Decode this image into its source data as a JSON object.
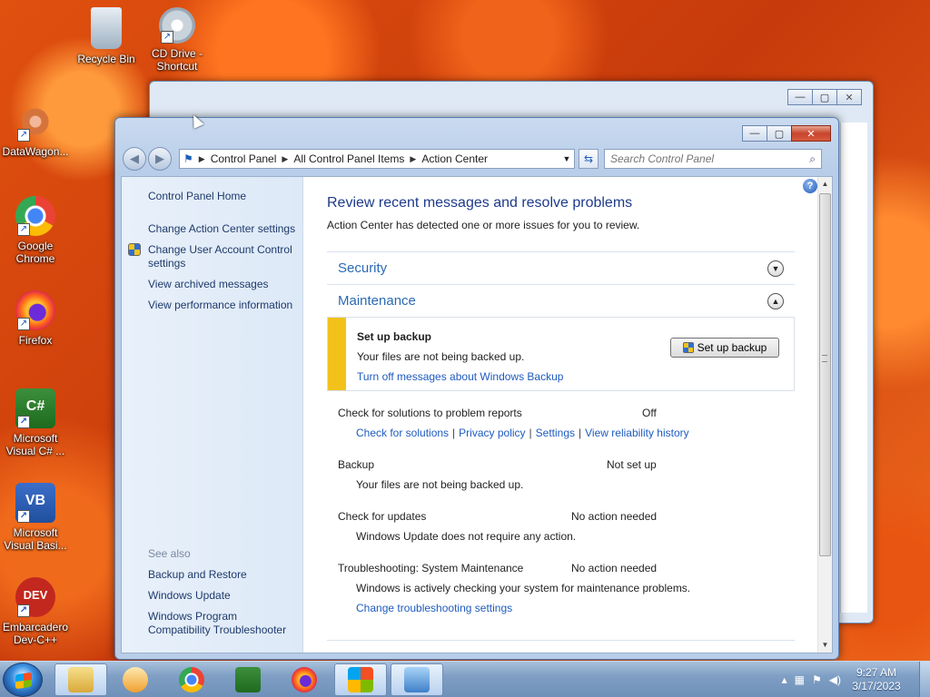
{
  "desktop": {
    "icons": [
      {
        "label": "Recycle Bin",
        "icon": "recycle-bin-icon"
      },
      {
        "label": "CD Drive - Shortcut",
        "icon": "cd-drive-icon"
      },
      {
        "label": "DataWagon...",
        "icon": "datawagon-icon"
      },
      {
        "label": "Google Chrome",
        "icon": "chrome-icon"
      },
      {
        "label": "Firefox",
        "icon": "firefox-icon"
      },
      {
        "label": "Microsoft Visual C# ...",
        "icon": "visual-csharp-icon"
      },
      {
        "label": "Microsoft Visual Basi...",
        "icon": "visual-basic-icon"
      },
      {
        "label": "Embarcadero Dev-C++",
        "icon": "devcpp-icon"
      }
    ]
  },
  "window": {
    "caption": {
      "minimize": "—",
      "maximize": "▢",
      "close": "✕"
    },
    "address": {
      "crumbs": [
        "Control Panel",
        "All Control Panel Items",
        "Action Center"
      ]
    },
    "search": {
      "placeholder": "Search Control Panel"
    },
    "sidebar": {
      "links": [
        "Control Panel Home",
        "Change Action Center settings",
        "Change User Account Control settings",
        "View archived messages",
        "View performance information"
      ],
      "see_also_label": "See also",
      "see_also": [
        "Backup and Restore",
        "Windows Update",
        "Windows Program Compatibility Troubleshooter"
      ]
    },
    "main": {
      "title": "Review recent messages and resolve problems",
      "subtitle": "Action Center has detected one or more issues for you to review.",
      "sections": {
        "security": "Security",
        "maintenance": "Maintenance"
      },
      "alert": {
        "title": "Set up backup",
        "desc": "Your files are not being backed up.",
        "link": "Turn off messages about Windows Backup",
        "button": "Set up backup"
      },
      "items": {
        "problem_reports": {
          "label": "Check for solutions to problem reports",
          "status": "Off",
          "links": [
            "Check for solutions",
            "Privacy policy",
            "Settings",
            "View reliability history"
          ]
        },
        "backup": {
          "label": "Backup",
          "status": "Not set up",
          "desc": "Your files are not being backed up."
        },
        "updates": {
          "label": "Check for updates",
          "status": "No action needed",
          "desc": "Windows Update does not require any action."
        },
        "troubleshooting": {
          "label": "Troubleshooting: System Maintenance",
          "status": "No action needed",
          "desc": "Windows is actively checking your system for maintenance problems.",
          "link": "Change troubleshooting settings"
        }
      }
    }
  },
  "taskbar": {
    "time": "9:27 AM",
    "date": "3/17/2023"
  }
}
